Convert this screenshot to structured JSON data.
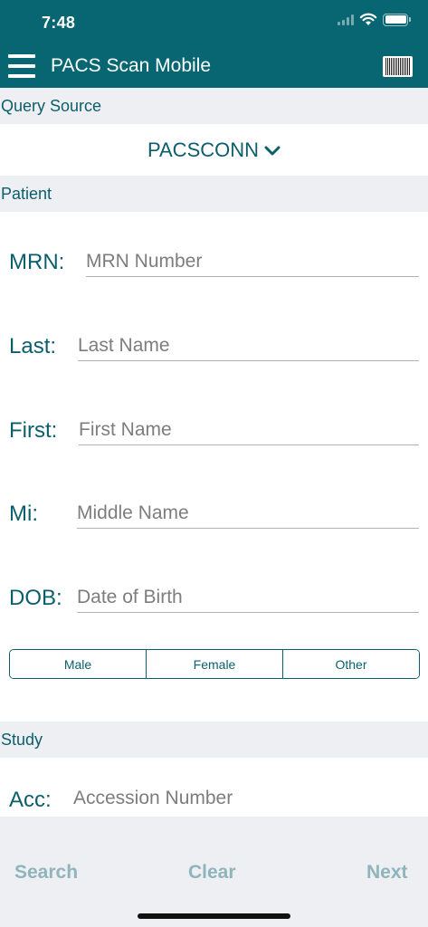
{
  "status": {
    "time": "7:48"
  },
  "header": {
    "title": "PACS Scan Mobile"
  },
  "query_source": {
    "label": "Query Source",
    "value": "PACSCONN"
  },
  "patient": {
    "label": "Patient",
    "mrn": {
      "label": "MRN:",
      "placeholder": "MRN Number"
    },
    "last": {
      "label": "Last:",
      "placeholder": "Last Name"
    },
    "first": {
      "label": "First:",
      "placeholder": "First Name"
    },
    "mi": {
      "label": "Mi:",
      "placeholder": "Middle Name"
    },
    "dob": {
      "label": "DOB:",
      "placeholder": "Date of Birth"
    },
    "gender_options": [
      "Male",
      "Female",
      "Other"
    ]
  },
  "study": {
    "label": "Study",
    "acc": {
      "label": "Acc:",
      "placeholder": "Accession Number"
    }
  },
  "footer": {
    "search": "Search",
    "clear": "Clear",
    "next": "Next"
  },
  "colors": {
    "primary": "#086672",
    "text_accent": "#0b5f6c",
    "section_bg": "#eeeff2",
    "footer_btn": "#8fb4bc"
  }
}
